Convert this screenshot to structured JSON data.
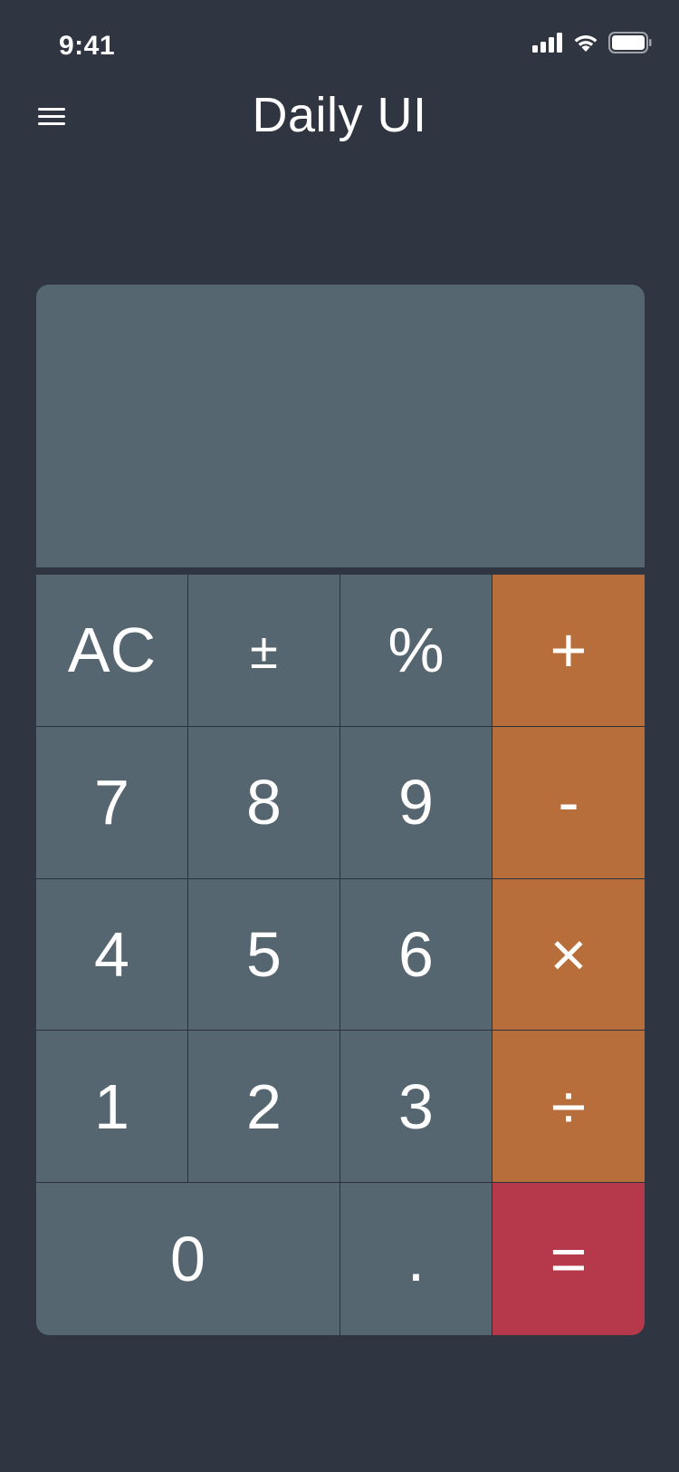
{
  "status_bar": {
    "time": "9:41",
    "icons": [
      "cellular-signal-icon",
      "wifi-icon",
      "battery-icon"
    ]
  },
  "header": {
    "menu_icon": "hamburger-menu-icon",
    "title": "Daily UI"
  },
  "display": {
    "value": ""
  },
  "keys": {
    "ac": "AC",
    "plus_minus": "±",
    "percent": "%",
    "add": "+",
    "seven": "7",
    "eight": "8",
    "nine": "9",
    "subtract": "-",
    "four": "4",
    "five": "5",
    "six": "6",
    "multiply": "×",
    "one": "1",
    "two": "2",
    "three": "3",
    "divide": "÷",
    "zero": "0",
    "decimal": ".",
    "equals": "="
  },
  "colors": {
    "background": "#303641",
    "key": "#566670",
    "operator": "#b86e3b",
    "equals": "#b5384b",
    "text": "#ffffff"
  }
}
